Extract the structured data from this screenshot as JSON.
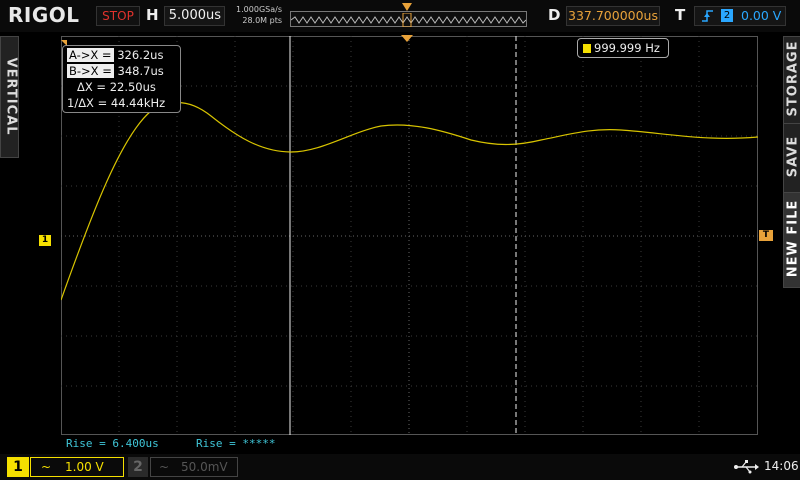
{
  "header": {
    "brand": "RIGOL",
    "run_state": "STOP",
    "h_label": "H",
    "timebase": "5.000us",
    "sample_rate": "1.000GSa/s",
    "mem_depth": "28.0M pts",
    "d_label": "D",
    "delay": "337.700000us",
    "t_label": "T",
    "trigger_source": "2",
    "trigger_level": "0.00 V"
  },
  "side_tabs": {
    "left": "VERTICAL",
    "right_top": "STORAGE",
    "right_middle": "SAVE",
    "right_bottom": "NEW FILE"
  },
  "markers": {
    "ch1_level": "1",
    "trigger_level": "T"
  },
  "cursor_readout": {
    "a_label": "A->X =",
    "a_value": "326.2us",
    "b_label": "B->X =",
    "b_value": "348.7us",
    "dx_label": "ΔX =",
    "dx_value": "22.50us",
    "inv_dx_label": "1/ΔX =",
    "inv_dx_value": "44.44kHz"
  },
  "frequency_counter": "999.999 Hz",
  "measurements": {
    "m1": "Rise = 6.400us",
    "m2": "Rise = *****"
  },
  "footer": {
    "ch1_num": "1",
    "ch1_coupling": "~",
    "ch1_scale": "1.00 V",
    "ch2_num": "2",
    "ch2_coupling": "~",
    "ch2_scale": "50.0mV",
    "time": "14:06"
  },
  "colors": {
    "ch1": "#f5e000",
    "trigger": "#e8a23a",
    "ch2": "#2aa7ff",
    "measure": "#3fc6d8",
    "stop": "#e0322c"
  }
}
